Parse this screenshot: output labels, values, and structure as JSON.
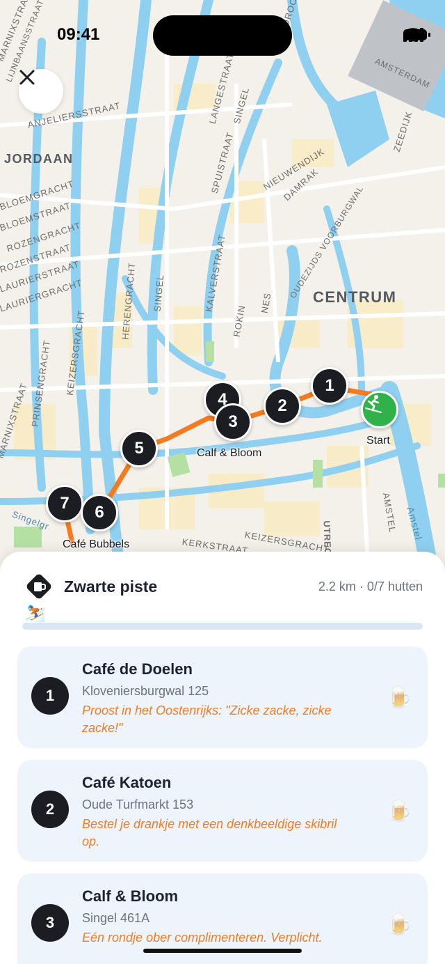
{
  "status_bar": {
    "time": "09:41"
  },
  "map": {
    "districts": [
      "JORDAAN",
      "CENTRUM"
    ],
    "streets": [
      "MARNIXSTRAAT",
      "LIJNBAANSSTRAAT",
      "ANJELIERSSTRAAT",
      "LANGESTRAAT",
      "SINGEL",
      "SPUISTRAAT",
      "NIEUWENDIJK",
      "DAMRAK",
      "ZEEDIJK",
      "OUDEZIJDS VOORBURGWAL",
      "BLOEMGRACHT",
      "BLOEMSTRAAT",
      "ROZENGRACHT",
      "ROZENSTRAAT",
      "LAURIERSTRAAT",
      "LAURIERGRACHT",
      "KALVERSTRAAT",
      "ROKIN",
      "NES",
      "SINGEL",
      "HERENGRACHT",
      "KEIZERSGRACHT",
      "PRINSENGRACHT",
      "MARNIXSTRAAT",
      "UTRECHTSE",
      "AMSTEL",
      "Amstel",
      "KERKSTRAAT",
      "KEIZERSGRACHT",
      "Singelgr",
      "DROOGBA",
      "AMSTERDAM"
    ],
    "pins": [
      {
        "number": "1"
      },
      {
        "number": "2"
      },
      {
        "number": "3"
      },
      {
        "number": "4"
      },
      {
        "number": "5"
      },
      {
        "number": "6"
      },
      {
        "number": "7"
      }
    ],
    "pin_labels": {
      "start": "Start",
      "calf_bloom": "Calf & Bloom",
      "cafe_bubbels": "Café Bubbels"
    },
    "route_color": "#f47b20",
    "start_color": "#2fb24a"
  },
  "route": {
    "title": "Zwarte piste",
    "meta": "2.2 km · 0/7 hutten",
    "progress": 0,
    "accent": "#f47b20"
  },
  "stops": [
    {
      "number": "1",
      "name": "Café de Doelen",
      "address": "Kloveniersburgwal 125",
      "tip": "Proost in het Oostenrijks: \"Zicke zacke, zicke zacke!\""
    },
    {
      "number": "2",
      "name": "Café Katoen",
      "address": "Oude Turfmarkt 153",
      "tip": "Bestel je drankje met een denkbeeldige skibril op."
    },
    {
      "number": "3",
      "name": "Calf & Bloom",
      "address": "Singel 461A",
      "tip": "Eén rondje ober complimenteren. Verplicht."
    }
  ]
}
